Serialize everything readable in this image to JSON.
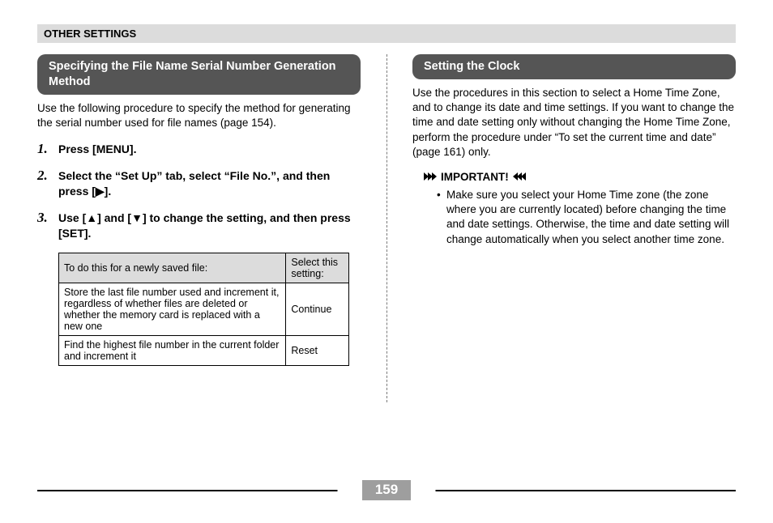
{
  "header": "OTHER SETTINGS",
  "left": {
    "title": "Specifying the File Name Serial Number Generation Method",
    "intro": "Use the following procedure to specify the method for generating the serial number used for file names (page 154).",
    "steps": [
      "Press [MENU].",
      "Select the “Set Up” tab, select “File No.”, and then press [▶].",
      "Use [▲] and [▼] to change the setting, and then press [SET]."
    ],
    "table": {
      "head": [
        "To do this for a newly saved file:",
        "Select this setting:"
      ],
      "rows": [
        [
          "Store the last file number used and increment it, regardless of whether files are deleted or whether the memory card is replaced with a new one",
          "Continue"
        ],
        [
          "Find the highest file number in the current folder and increment it",
          "Reset"
        ]
      ]
    }
  },
  "right": {
    "title": "Setting the Clock",
    "intro": "Use the procedures in this section to select a Home Time Zone, and to change its date and time settings. If you want to change the time and date setting only without changing the Home Time Zone, perform the procedure under “To set the current time and date” (page 161) only.",
    "important_label": "IMPORTANT!",
    "important_text": "Make sure you select your Home Time zone (the zone where you are currently located) before changing the time and date settings. Otherwise, the time and date setting will change automatically when you select another time zone."
  },
  "page_number": "159"
}
